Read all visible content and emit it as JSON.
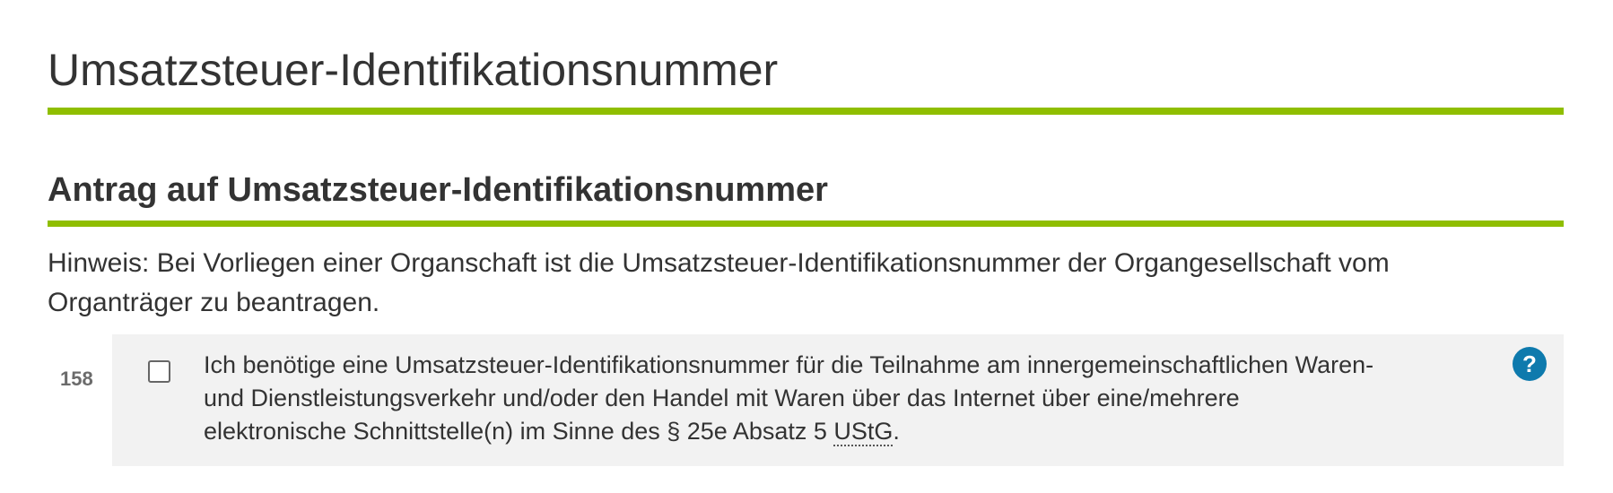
{
  "page": {
    "title": "Umsatzsteuer-Identifikationsnummer"
  },
  "section": {
    "title": "Antrag auf Umsatzsteuer-Identifikationsnummer",
    "hint_line1": "Hinweis: Bei Vorliegen einer Organschaft ist die Umsatzsteuer-Identifikationsnummer der Organgesellschaft vom",
    "hint_line2": "Organträger zu beantragen."
  },
  "field": {
    "number": "158",
    "checked": false,
    "label_line1": "Ich benötige eine Umsatzsteuer-Identifikationsnummer für die Teilnahme am innergemeinschaftlichen Waren-",
    "label_line2": "und Dienstleistungsverkehr und/oder den Handel mit Waren über das Internet über eine/mehrere",
    "label_line3_before": "elektronische Schnittstelle(n) im Sinne des § 25e Absatz 5 ",
    "label_abbr": "UStG",
    "label_line3_after": ".",
    "help_glyph": "?",
    "help_icon_name": "help-question-icon",
    "help_icon_color": "#0e7aad"
  },
  "colors": {
    "accent_rule": "#8fbe00",
    "row_background": "#f2f2f2",
    "text": "#333333"
  }
}
